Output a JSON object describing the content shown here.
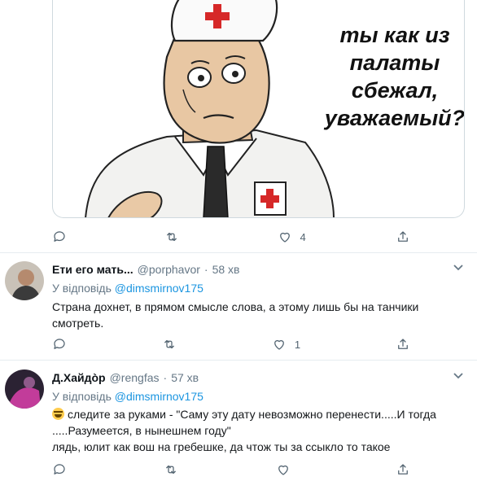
{
  "tweet1": {
    "meme_caption_lines": [
      "ты как из",
      "палаты сбежал,",
      "уважаемый?"
    ],
    "actions": {
      "reply_count": "",
      "retweet_count": "",
      "like_count": "4"
    }
  },
  "replies": [
    {
      "name": "Ети его мать...",
      "handle": "@porphavor",
      "dot": "·",
      "time": "58 хв",
      "replying_prefix": "У відповідь",
      "replying_to": "@dimsmirnov175",
      "text": "Страна дохнет, в прямом смысле слова, а этому лишь бы на танчики смотреть.",
      "like_count": "1"
    },
    {
      "name": "Д.Хайдòр",
      "handle": "@rengfas",
      "dot": "·",
      "time": "57 хв",
      "replying_prefix": "У відповідь",
      "replying_to": "@dimsmirnov175",
      "text_line1": "следите за руками - \"Саму эту дату невозможно перенести.....И тогда",
      "text_line2": ".....Разумеется, в нынешнем году\"",
      "text_line3": "лядь, юлит как вош на гребешке, да чтож ты за ссыкло то такое",
      "like_count": ""
    }
  ],
  "icons": {
    "reply": "reply-icon",
    "retweet": "retweet-icon",
    "like": "heart-icon",
    "share": "share-icon",
    "caret": "chevron-down-icon",
    "emoji": "rolling-on-floor-laughing-emoji"
  },
  "colors": {
    "link": "#1b95e0",
    "secondary_text": "#657786",
    "divider": "#e6ecf0"
  }
}
